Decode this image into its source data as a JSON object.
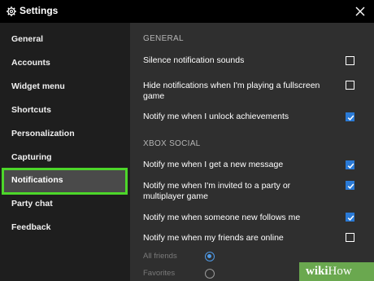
{
  "window": {
    "title": "Settings",
    "title_icon": "gear-icon",
    "close_icon": "close-icon"
  },
  "sidebar": {
    "items": [
      {
        "label": "General"
      },
      {
        "label": "Accounts"
      },
      {
        "label": "Widget menu"
      },
      {
        "label": "Shortcuts"
      },
      {
        "label": "Personalization"
      },
      {
        "label": "Capturing"
      },
      {
        "label": "Notifications",
        "active": true
      },
      {
        "label": "Party chat"
      },
      {
        "label": "Feedback"
      }
    ]
  },
  "main": {
    "general_header": "GENERAL",
    "general": [
      {
        "label": "Silence notification sounds",
        "checked": false
      },
      {
        "label": "Hide notifications when I'm playing a fullscreen game",
        "checked": false
      },
      {
        "label": "Notify me when I unlock achievements",
        "checked": true
      }
    ],
    "social_header": "XBOX SOCIAL",
    "social": [
      {
        "label": "Notify me when I get a new message",
        "checked": true
      },
      {
        "label": "Notify me when I'm invited to a party or multiplayer game",
        "checked": true
      },
      {
        "label": "Notify me when someone new follows me",
        "checked": true
      },
      {
        "label": "Notify me when my friends are online",
        "checked": false
      }
    ],
    "online_options": [
      {
        "label": "All friends",
        "selected": true
      },
      {
        "label": "Favorites",
        "selected": false
      }
    ]
  },
  "colors": {
    "accent": "#2a7ad6",
    "highlight": "#4dd62a",
    "watermark": "#6aa84f"
  },
  "watermark": {
    "wiki": "wiki",
    "how": "How"
  }
}
